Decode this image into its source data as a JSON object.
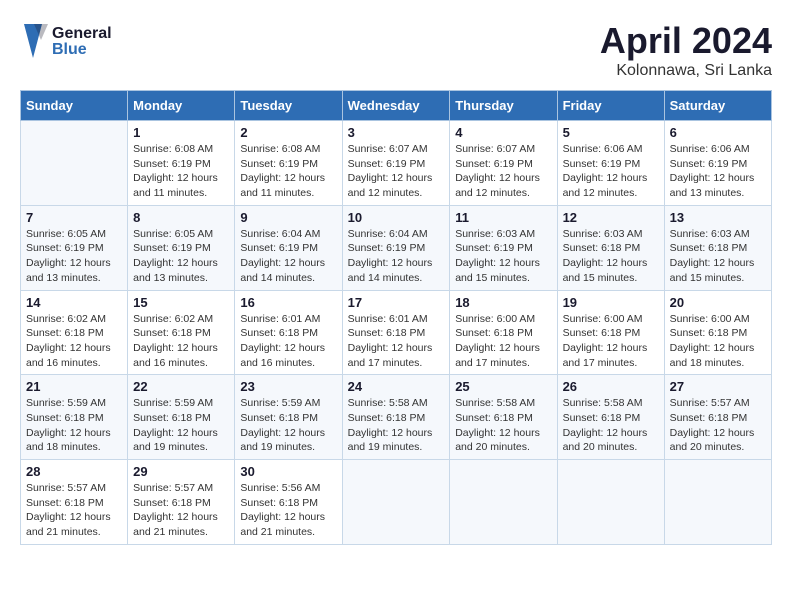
{
  "header": {
    "logo_general": "General",
    "logo_blue": "Blue",
    "title": "April 2024",
    "subtitle": "Kolonnawa, Sri Lanka"
  },
  "days_of_week": [
    "Sunday",
    "Monday",
    "Tuesday",
    "Wednesday",
    "Thursday",
    "Friday",
    "Saturday"
  ],
  "weeks": [
    [
      {
        "num": "",
        "detail": ""
      },
      {
        "num": "1",
        "detail": "Sunrise: 6:08 AM\nSunset: 6:19 PM\nDaylight: 12 hours and 11 minutes."
      },
      {
        "num": "2",
        "detail": "Sunrise: 6:08 AM\nSunset: 6:19 PM\nDaylight: 12 hours and 11 minutes."
      },
      {
        "num": "3",
        "detail": "Sunrise: 6:07 AM\nSunset: 6:19 PM\nDaylight: 12 hours and 12 minutes."
      },
      {
        "num": "4",
        "detail": "Sunrise: 6:07 AM\nSunset: 6:19 PM\nDaylight: 12 hours and 12 minutes."
      },
      {
        "num": "5",
        "detail": "Sunrise: 6:06 AM\nSunset: 6:19 PM\nDaylight: 12 hours and 12 minutes."
      },
      {
        "num": "6",
        "detail": "Sunrise: 6:06 AM\nSunset: 6:19 PM\nDaylight: 12 hours and 13 minutes."
      }
    ],
    [
      {
        "num": "7",
        "detail": "Sunrise: 6:05 AM\nSunset: 6:19 PM\nDaylight: 12 hours and 13 minutes."
      },
      {
        "num": "8",
        "detail": "Sunrise: 6:05 AM\nSunset: 6:19 PM\nDaylight: 12 hours and 13 minutes."
      },
      {
        "num": "9",
        "detail": "Sunrise: 6:04 AM\nSunset: 6:19 PM\nDaylight: 12 hours and 14 minutes."
      },
      {
        "num": "10",
        "detail": "Sunrise: 6:04 AM\nSunset: 6:19 PM\nDaylight: 12 hours and 14 minutes."
      },
      {
        "num": "11",
        "detail": "Sunrise: 6:03 AM\nSunset: 6:19 PM\nDaylight: 12 hours and 15 minutes."
      },
      {
        "num": "12",
        "detail": "Sunrise: 6:03 AM\nSunset: 6:18 PM\nDaylight: 12 hours and 15 minutes."
      },
      {
        "num": "13",
        "detail": "Sunrise: 6:03 AM\nSunset: 6:18 PM\nDaylight: 12 hours and 15 minutes."
      }
    ],
    [
      {
        "num": "14",
        "detail": "Sunrise: 6:02 AM\nSunset: 6:18 PM\nDaylight: 12 hours and 16 minutes."
      },
      {
        "num": "15",
        "detail": "Sunrise: 6:02 AM\nSunset: 6:18 PM\nDaylight: 12 hours and 16 minutes."
      },
      {
        "num": "16",
        "detail": "Sunrise: 6:01 AM\nSunset: 6:18 PM\nDaylight: 12 hours and 16 minutes."
      },
      {
        "num": "17",
        "detail": "Sunrise: 6:01 AM\nSunset: 6:18 PM\nDaylight: 12 hours and 17 minutes."
      },
      {
        "num": "18",
        "detail": "Sunrise: 6:00 AM\nSunset: 6:18 PM\nDaylight: 12 hours and 17 minutes."
      },
      {
        "num": "19",
        "detail": "Sunrise: 6:00 AM\nSunset: 6:18 PM\nDaylight: 12 hours and 17 minutes."
      },
      {
        "num": "20",
        "detail": "Sunrise: 6:00 AM\nSunset: 6:18 PM\nDaylight: 12 hours and 18 minutes."
      }
    ],
    [
      {
        "num": "21",
        "detail": "Sunrise: 5:59 AM\nSunset: 6:18 PM\nDaylight: 12 hours and 18 minutes."
      },
      {
        "num": "22",
        "detail": "Sunrise: 5:59 AM\nSunset: 6:18 PM\nDaylight: 12 hours and 19 minutes."
      },
      {
        "num": "23",
        "detail": "Sunrise: 5:59 AM\nSunset: 6:18 PM\nDaylight: 12 hours and 19 minutes."
      },
      {
        "num": "24",
        "detail": "Sunrise: 5:58 AM\nSunset: 6:18 PM\nDaylight: 12 hours and 19 minutes."
      },
      {
        "num": "25",
        "detail": "Sunrise: 5:58 AM\nSunset: 6:18 PM\nDaylight: 12 hours and 20 minutes."
      },
      {
        "num": "26",
        "detail": "Sunrise: 5:58 AM\nSunset: 6:18 PM\nDaylight: 12 hours and 20 minutes."
      },
      {
        "num": "27",
        "detail": "Sunrise: 5:57 AM\nSunset: 6:18 PM\nDaylight: 12 hours and 20 minutes."
      }
    ],
    [
      {
        "num": "28",
        "detail": "Sunrise: 5:57 AM\nSunset: 6:18 PM\nDaylight: 12 hours and 21 minutes."
      },
      {
        "num": "29",
        "detail": "Sunrise: 5:57 AM\nSunset: 6:18 PM\nDaylight: 12 hours and 21 minutes."
      },
      {
        "num": "30",
        "detail": "Sunrise: 5:56 AM\nSunset: 6:18 PM\nDaylight: 12 hours and 21 minutes."
      },
      {
        "num": "",
        "detail": ""
      },
      {
        "num": "",
        "detail": ""
      },
      {
        "num": "",
        "detail": ""
      },
      {
        "num": "",
        "detail": ""
      }
    ]
  ]
}
